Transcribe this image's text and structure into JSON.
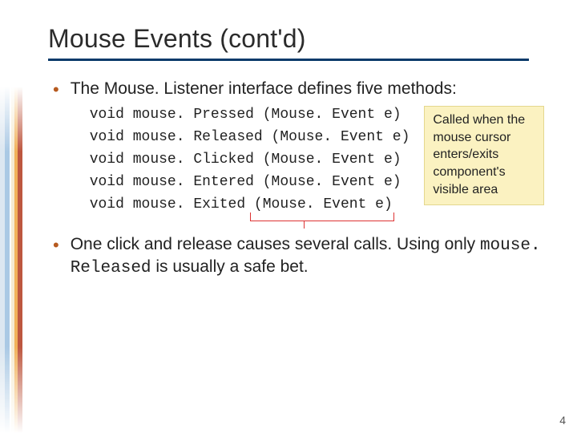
{
  "title": "Mouse Events (cont'd)",
  "bullet1": "The Mouse. Listener interface defines five methods:",
  "methods": {
    "m1": "void mouse. Pressed (Mouse. Event e)",
    "m2": "void mouse. Released (Mouse. Event e)",
    "m3": "void mouse. Clicked (Mouse. Event e)",
    "m4": "void mouse. Entered (Mouse. Event e)",
    "m5": "void mouse. Exited (Mouse. Event e)"
  },
  "callout": "Called when the mouse cursor enters/exits component's visible area",
  "bullet2_a": "One click and release causes several calls. Using only ",
  "bullet2_code": "mouse. Released",
  "bullet2_b": " is usually a safe bet.",
  "page_number": "4"
}
